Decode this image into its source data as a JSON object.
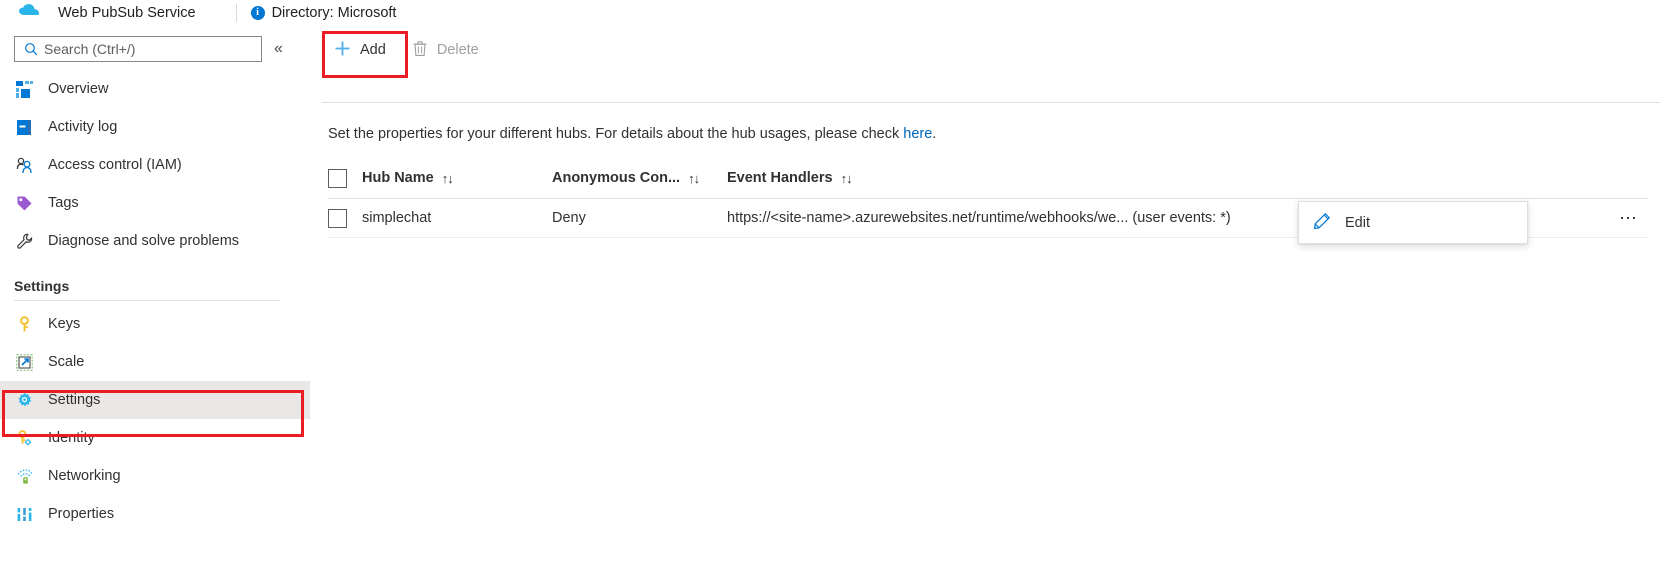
{
  "topbar": {
    "service_title": "Web PubSub Service",
    "directory_label": "Directory: Microsoft",
    "logo_icon": "azure-web-pubsub-icon",
    "info_icon": "info-icon"
  },
  "sidebar": {
    "search": {
      "placeholder": "Search (Ctrl+/)",
      "value": "",
      "icon": "search-icon"
    },
    "collapse_icon": "chevron-double-left-icon",
    "primary_items": [
      {
        "label": "Overview",
        "icon": "overview-grid-icon"
      },
      {
        "label": "Activity log",
        "icon": "activity-log-icon"
      },
      {
        "label": "Access control (IAM)",
        "icon": "access-control-people-icon"
      },
      {
        "label": "Tags",
        "icon": "tag-icon"
      },
      {
        "label": "Diagnose and solve problems",
        "icon": "wrench-icon"
      }
    ],
    "settings_group": {
      "title": "Settings",
      "items": [
        {
          "label": "Keys",
          "icon": "key-icon",
          "selected": false
        },
        {
          "label": "Scale",
          "icon": "scale-arrow-icon",
          "selected": false
        },
        {
          "label": "Settings",
          "icon": "gear-icon",
          "selected": true
        },
        {
          "label": "Identity",
          "icon": "identity-key-icon",
          "selected": false
        },
        {
          "label": "Networking",
          "icon": "networking-icon",
          "selected": false
        },
        {
          "label": "Properties",
          "icon": "properties-bars-icon",
          "selected": false
        }
      ]
    }
  },
  "highlights": {
    "add_button_color": "#ec1c24",
    "settings_item_color": "#ec1c24"
  },
  "command_bar": {
    "add": {
      "label": "Add",
      "icon": "plus-icon",
      "disabled": false
    },
    "delete": {
      "label": "Delete",
      "icon": "trash-icon",
      "disabled": true
    }
  },
  "main": {
    "description_prefix": "Set the properties for your different hubs. For details about the hub usages, please check ",
    "description_link": "here",
    "description_suffix": ".",
    "link_color": "#0067b8"
  },
  "table": {
    "columns": [
      {
        "key": "hub_name",
        "label": "Hub Name",
        "sortable": true
      },
      {
        "key": "anonymous_connect",
        "label": "Anonymous Con...",
        "sortable": true
      },
      {
        "key": "event_handlers",
        "label": "Event Handlers",
        "sortable": true
      }
    ],
    "sort_glyph": "↑↓",
    "rows": [
      {
        "hub_name": "simplechat",
        "anonymous_connect": "Deny",
        "event_handlers": "https://<site-name>.azurewebsites.net/runtime/webhooks/we... (user events: *)",
        "menu_icon": "ellipsis-icon"
      }
    ]
  },
  "context_menu": {
    "items": [
      {
        "label": "Edit",
        "icon": "pencil-edit-icon"
      }
    ]
  }
}
